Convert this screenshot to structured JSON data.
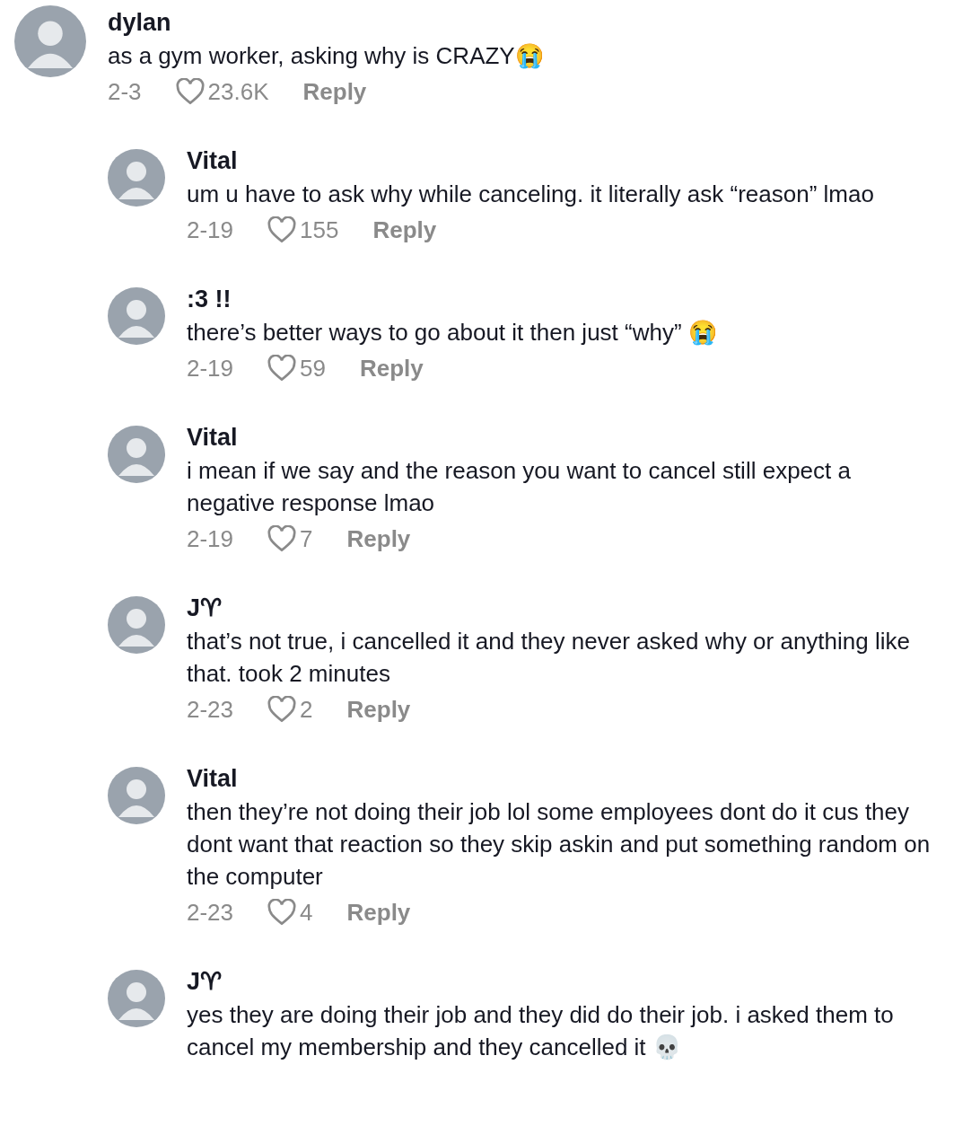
{
  "comment": {
    "user": "dylan",
    "text": "as a gym worker, asking why is CRAZY😭",
    "date": "2-3",
    "likes": "23.6K",
    "reply": "Reply",
    "replies": [
      {
        "user": "Vital",
        "text": "um u have to ask why while canceling. it literally ask “reason” lmao",
        "date": "2-19",
        "likes": "155",
        "reply": "Reply"
      },
      {
        "user": ":3 !!",
        "text": "there’s better ways to go about it then just “why” 😭",
        "date": "2-19",
        "likes": "59",
        "reply": "Reply"
      },
      {
        "user": "Vital",
        "text": "i mean if we say and the reason you want to cancel still expect a negative response lmao",
        "date": "2-19",
        "likes": "7",
        "reply": "Reply"
      },
      {
        "user": "J♈︎",
        "text": "that’s not true, i cancelled it and they never asked why or anything like that. took 2 minutes",
        "date": "2-23",
        "likes": "2",
        "reply": "Reply"
      },
      {
        "user": "Vital",
        "text": "then they’re not doing their job lol some employees dont do it cus they dont want that reaction so they skip askin and put something random on the computer",
        "date": "2-23",
        "likes": "4",
        "reply": "Reply"
      },
      {
        "user": "J♈︎",
        "text": "yes they are doing their job and they did do their job. i asked them to cancel my membership and they cancelled it 💀"
      }
    ]
  }
}
